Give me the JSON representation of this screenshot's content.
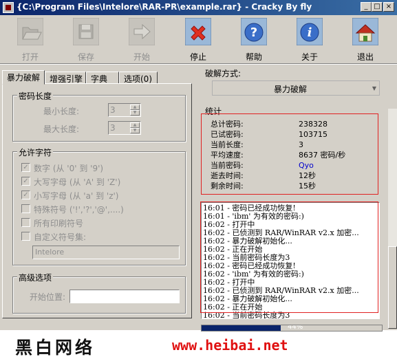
{
  "window": {
    "title": "{C:\\Program Files\\Intelore\\RAR-PR\\example.rar} - Cracky By fly",
    "controls": {
      "minimize": "_",
      "maximize": "□",
      "close": "×"
    }
  },
  "toolbar": {
    "items": [
      {
        "label": "打开",
        "icon": "open-folder-icon",
        "enabled": false
      },
      {
        "label": "保存",
        "icon": "save-disk-icon",
        "enabled": false
      },
      {
        "label": "开始",
        "icon": "start-arrow-icon",
        "enabled": false
      },
      {
        "label": "停止",
        "icon": "stop-x-icon",
        "enabled": true
      },
      {
        "label": "帮助",
        "icon": "help-question-icon",
        "enabled": true
      },
      {
        "label": "关于",
        "icon": "about-info-icon",
        "enabled": true
      },
      {
        "label": "退出",
        "icon": "exit-house-icon",
        "enabled": true
      }
    ]
  },
  "tabs": [
    {
      "label": "暴力破解",
      "active": true
    },
    {
      "label": "增强引擎",
      "active": false
    },
    {
      "label": "字典",
      "active": false
    },
    {
      "label": "选项(0)",
      "active": false
    }
  ],
  "password_length": {
    "title": "密码长度",
    "min_label": "最小长度:",
    "min_value": "3",
    "max_label": "最大长度:",
    "max_value": "3"
  },
  "charset": {
    "title": "允许字符",
    "options": [
      {
        "label": "数字 (从 '0' 到 '9')",
        "checked": true
      },
      {
        "label": "大写字母 (从 'A' 到 'Z')",
        "checked": true
      },
      {
        "label": "小写字母 (从 'a' 到 'z')",
        "checked": true
      },
      {
        "label": "特殊符号 ('!','?','@',....)",
        "checked": false
      },
      {
        "label": "所有印刷符号",
        "checked": false
      },
      {
        "label": "自定义符号集:",
        "checked": false
      }
    ],
    "custom_value": "Intelore"
  },
  "advanced": {
    "title": "高级选项",
    "start_label": "开始位置:",
    "start_value": ""
  },
  "crack_mode": {
    "title": "破解方式:",
    "value": "暴力破解"
  },
  "stats": {
    "title": "统计",
    "rows": [
      {
        "label": "总计密码:",
        "value": "238328"
      },
      {
        "label": "已试密码:",
        "value": "103715"
      },
      {
        "label": "当前长度:",
        "value": "3"
      },
      {
        "label": "平均速度:",
        "value": "8637 密码/秒"
      },
      {
        "label": "当前密码:",
        "value": "Qyo",
        "color": "#0000cc"
      },
      {
        "label": "逝去时间:",
        "value": "12秒"
      },
      {
        "label": "剩余时间:",
        "value": "15秒"
      }
    ]
  },
  "log": [
    "16:01 - 密码已经成功恢复!",
    "16:01 - 'ibm' 为有效的密码:)",
    "16:02 - 打开中",
    "16:02 - 已侦测到 RAR/WinRAR v2.x 加密...",
    "16:02 - 暴力破解初始化...",
    "16:02 - 正在开始",
    "16:02 - 当前密码长度为3",
    "16:02 - 密码已经成功恢复!",
    "16:02 - 'ibm' 为有效的密码:)",
    "16:02 - 打开中",
    "16:02 - 已侦测到 RAR/WinRAR v2.x 加密...",
    "16:02 - 暴力破解初始化...",
    "16:02 - 正在开始",
    "16:02 - 当前密码长度为3"
  ],
  "progress": {
    "text": "44%",
    "percent": 44
  },
  "banner": {
    "name": "黑白网络",
    "url": "www.heibai.net"
  }
}
